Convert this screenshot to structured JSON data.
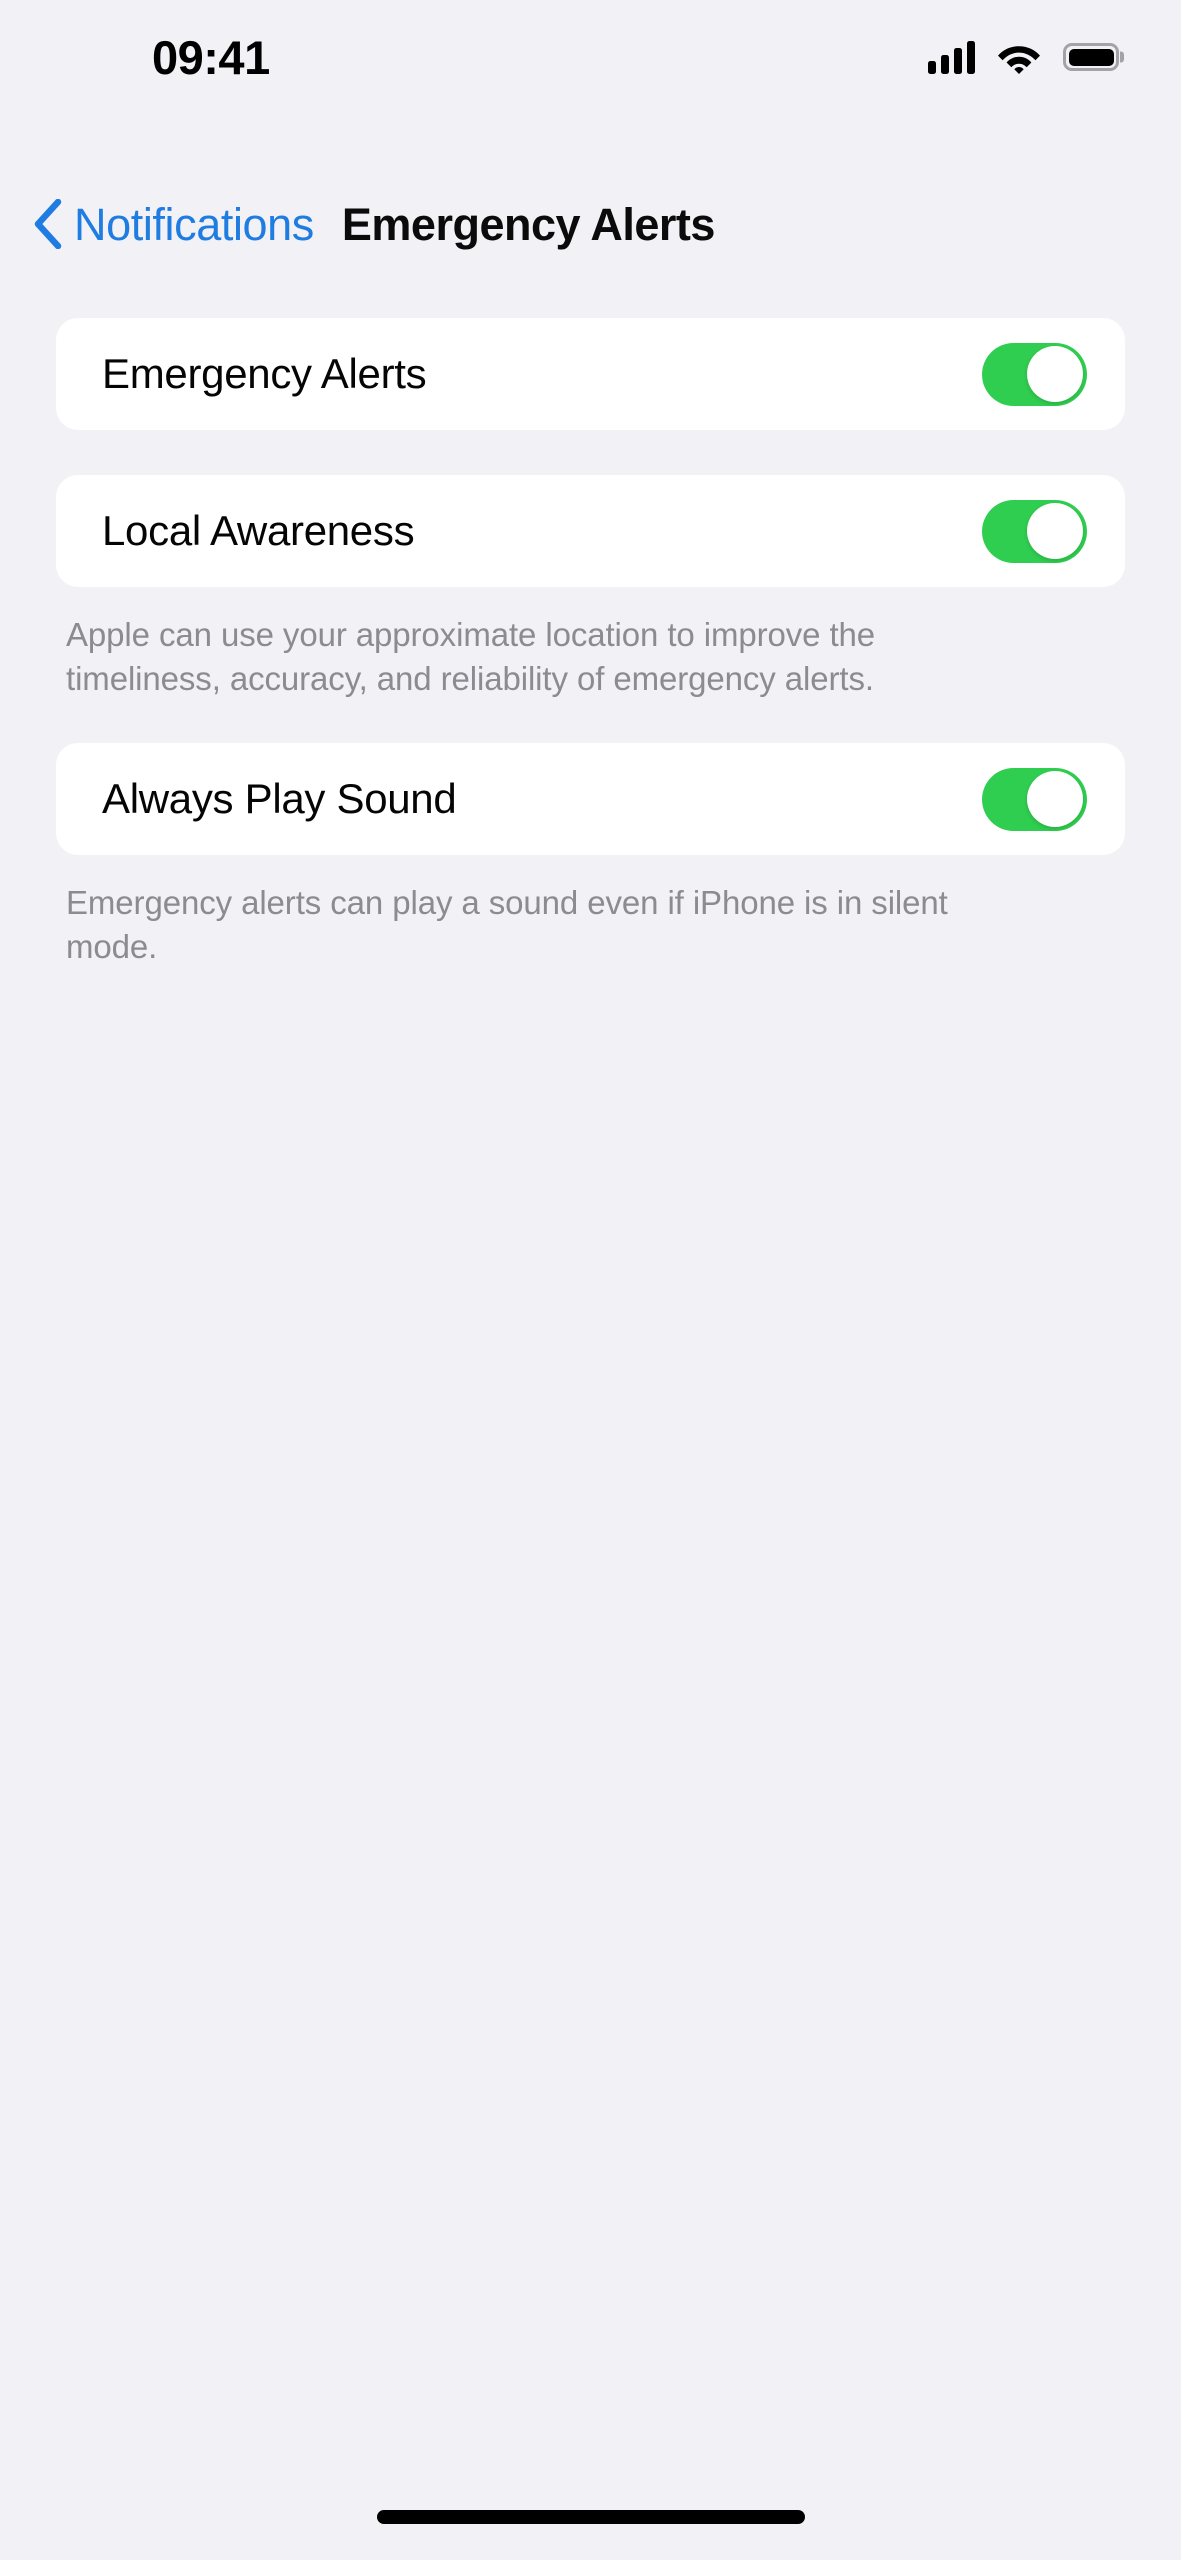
{
  "status_bar": {
    "time": "09:41",
    "signal_icon": "cellular-signal-icon",
    "signal_bars": 4,
    "wifi_icon": "wifi-icon",
    "battery_icon": "battery-icon",
    "battery_level": 100
  },
  "nav": {
    "back_icon": "chevron-left-icon",
    "back_label": "Notifications",
    "title": "Emergency Alerts"
  },
  "colors": {
    "background": "#F1F1F6",
    "card": "#FFFFFF",
    "accent_blue": "#1F7CE0",
    "toggle_on_green": "#30CE50",
    "footer_gray": "#8B8B90",
    "label_black": "#050506"
  },
  "sections": [
    {
      "rows": [
        {
          "label": "Emergency Alerts",
          "toggle_state": "on",
          "toggle_label": "Emergency Alerts toggle"
        }
      ],
      "footer": ""
    },
    {
      "rows": [
        {
          "label": "Local Awareness",
          "toggle_state": "on",
          "toggle_label": "Local Awareness toggle"
        }
      ],
      "footer": "Apple can use your approximate location to improve the timeliness, accuracy, and reliability of emergency alerts."
    },
    {
      "rows": [
        {
          "label": "Always Play Sound",
          "toggle_state": "on",
          "toggle_label": "Always Play Sound toggle"
        }
      ],
      "footer": "Emergency alerts can play a sound even if iPhone is in silent mode."
    }
  ],
  "home_indicator": "home-indicator"
}
